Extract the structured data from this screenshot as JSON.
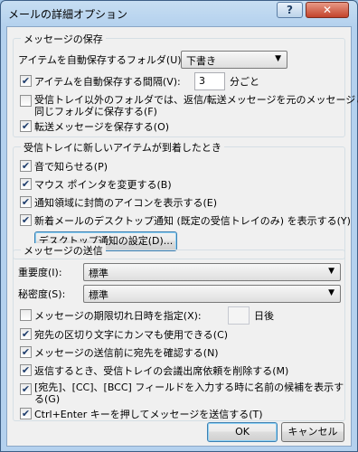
{
  "window": {
    "title": "メールの詳細オプション",
    "help_label": "?",
    "close_label": "✕"
  },
  "save": {
    "heading": "メッセージの保存",
    "folder_label": "アイテムを自動保存するフォルダ(U):",
    "folder_value": "下書き",
    "autosave_label": "アイテムを自動保存する間隔(V):",
    "autosave_checked": true,
    "interval_value": "3",
    "interval_unit": "分ごと",
    "save_replies_label_1": "受信トレイ以外のフォルダでは、返信/転送メッセージを元のメッセージと",
    "save_replies_label_2": "同じフォルダに保存する(F)",
    "save_replies_checked": false,
    "save_forwarded_label": "転送メッセージを保存する(O)",
    "save_forwarded_checked": true
  },
  "arrival": {
    "heading": "受信トレイに新しいアイテムが到着したとき",
    "sound_label": "音で知らせる(P)",
    "sound_checked": true,
    "cursor_label": "マウス ポインタを変更する(B)",
    "cursor_checked": true,
    "envelope_label": "通知領域に封筒のアイコンを表示する(E)",
    "envelope_checked": true,
    "desktop_alert_label": "新着メールのデスクトップ通知 (既定の受信トレイのみ) を表示する(Y)",
    "desktop_alert_checked": true,
    "desktop_settings_button": "デスクトップ通知の設定(D)..."
  },
  "send": {
    "heading": "メッセージの送信",
    "importance_label": "重要度(I):",
    "importance_value": "標準",
    "sensitivity_label": "秘密度(S):",
    "sensitivity_value": "標準",
    "expire_label": "メッセージの期限切れ日時を指定(X):",
    "expire_checked": false,
    "expire_value": "",
    "expire_unit": "日後",
    "commas_label": "宛先の区切り文字にカンマも使用できる(C)",
    "commas_checked": true,
    "check_names_label": "メッセージの送信前に宛先を確認する(N)",
    "check_names_checked": true,
    "delete_requests_label": "返信するとき、受信トレイの会議出席依頼を削除する(M)",
    "delete_requests_checked": true,
    "suggest_names_label_1": "[宛先]、[CC]、[BCC] フィールドを入力する時に名前の候補を表示す",
    "suggest_names_label_2": "る(G)",
    "suggest_names_checked": true,
    "ctrl_enter_label": "Ctrl+Enter キーを押してメッセージを送信する(T)",
    "ctrl_enter_checked": true
  },
  "footer": {
    "ok_label": "OK",
    "cancel_label": "キャンセル"
  }
}
